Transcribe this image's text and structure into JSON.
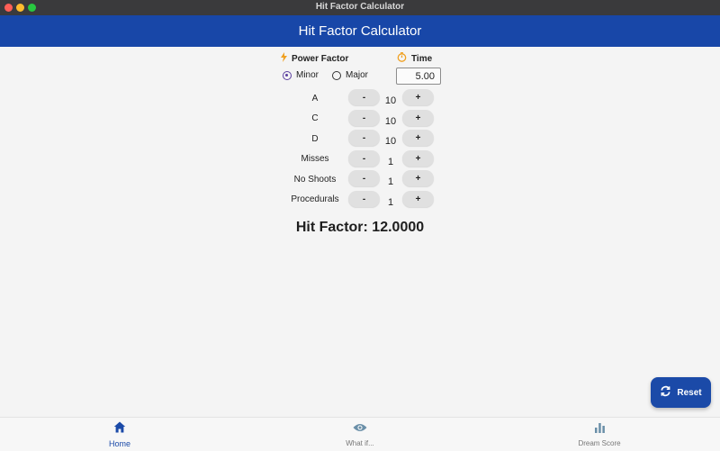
{
  "window": {
    "title": "Hit Factor Calculator"
  },
  "appbar": {
    "title": "Hit Factor Calculator"
  },
  "power_factor": {
    "label": "Power Factor",
    "options": [
      {
        "label": "Minor",
        "selected": true
      },
      {
        "label": "Major",
        "selected": false
      }
    ]
  },
  "time": {
    "label": "Time",
    "value": "5.00"
  },
  "rows": [
    {
      "label": "A",
      "count": "10",
      "minus": "-",
      "plus": "+"
    },
    {
      "label": "C",
      "count": "10",
      "minus": "-",
      "plus": "+"
    },
    {
      "label": "D",
      "count": "10",
      "minus": "-",
      "plus": "+"
    },
    {
      "label": "Misses",
      "count": "1",
      "minus": "-",
      "plus": "+"
    },
    {
      "label": "No Shoots",
      "count": "1",
      "minus": "-",
      "plus": "+"
    },
    {
      "label": "Procedurals",
      "count": "1",
      "minus": "-",
      "plus": "+"
    }
  ],
  "result": {
    "text": "Hit Factor: 12.0000"
  },
  "reset": {
    "label": "Reset"
  },
  "nav": {
    "items": [
      {
        "label": "Home",
        "icon": "home-icon",
        "active": true
      },
      {
        "label": "What if...",
        "icon": "eye-icon",
        "active": false
      },
      {
        "label": "Dream Score",
        "icon": "bar-chart-icon",
        "active": false
      }
    ]
  },
  "colors": {
    "primary": "#1847a8",
    "radio": "#5b3fa0",
    "accent": "#f0a020"
  }
}
